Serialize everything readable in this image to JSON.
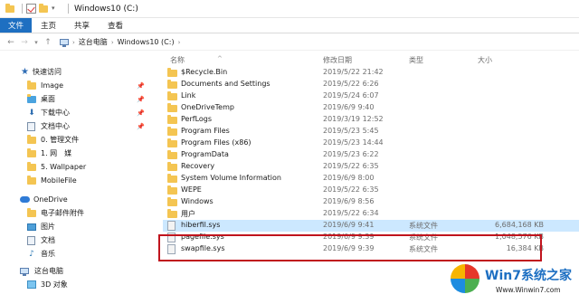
{
  "window": {
    "title": "Windows10 (C:)"
  },
  "ribbon": {
    "tabs": [
      "文件",
      "主页",
      "共享",
      "查看"
    ]
  },
  "address": {
    "parts": [
      "这台电脑",
      "Windows10 (C:)"
    ]
  },
  "navpane": {
    "quick_access": "快速访问",
    "items": [
      {
        "label": "Image",
        "pinned": true
      },
      {
        "label": "桌面",
        "pinned": true
      },
      {
        "label": "下载中心",
        "pinned": true
      },
      {
        "label": "文档中心",
        "pinned": true
      },
      {
        "label": "0. 管理文件",
        "pinned": false
      },
      {
        "label": "1. 网　媒",
        "pinned": false
      },
      {
        "label": "5. Wallpaper",
        "pinned": false
      },
      {
        "label": "MobileFile",
        "pinned": false
      }
    ],
    "onedrive": "OneDrive",
    "onedrive_items": [
      "电子邮件附件",
      "图片",
      "文档",
      "音乐"
    ],
    "this_pc": "这台电脑",
    "pc_items": [
      "3D 对象"
    ]
  },
  "columns": {
    "name": "名称",
    "date": "修改日期",
    "type": "类型",
    "size": "大小"
  },
  "files": [
    {
      "name": "$Recycle.Bin",
      "date": "2019/5/22 21:42",
      "type": "",
      "size": "",
      "icon": "folder"
    },
    {
      "name": "Documents and Settings",
      "date": "2019/5/22 6:26",
      "type": "",
      "size": "",
      "icon": "folder-link"
    },
    {
      "name": "Link",
      "date": "2019/5/24 6:07",
      "type": "",
      "size": "",
      "icon": "folder"
    },
    {
      "name": "OneDriveTemp",
      "date": "2019/6/9 9:40",
      "type": "",
      "size": "",
      "icon": "folder"
    },
    {
      "name": "PerfLogs",
      "date": "2019/3/19 12:52",
      "type": "",
      "size": "",
      "icon": "folder"
    },
    {
      "name": "Program Files",
      "date": "2019/5/23 5:45",
      "type": "",
      "size": "",
      "icon": "folder"
    },
    {
      "name": "Program Files (x86)",
      "date": "2019/5/23 14:44",
      "type": "",
      "size": "",
      "icon": "folder"
    },
    {
      "name": "ProgramData",
      "date": "2019/5/23 6:22",
      "type": "",
      "size": "",
      "icon": "folder"
    },
    {
      "name": "Recovery",
      "date": "2019/5/22 6:35",
      "type": "",
      "size": "",
      "icon": "folder"
    },
    {
      "name": "System Volume Information",
      "date": "2019/6/9 8:00",
      "type": "",
      "size": "",
      "icon": "folder"
    },
    {
      "name": "WEPE",
      "date": "2019/5/22 6:35",
      "type": "",
      "size": "",
      "icon": "folder"
    },
    {
      "name": "Windows",
      "date": "2019/6/9 8:56",
      "type": "",
      "size": "",
      "icon": "folder"
    },
    {
      "name": "用户",
      "date": "2019/5/22 6:34",
      "type": "",
      "size": "",
      "icon": "folder"
    },
    {
      "name": "hiberfil.sys",
      "date": "2019/6/9 9:41",
      "type": "系统文件",
      "size": "6,684,168 KB",
      "icon": "file",
      "selected": true
    },
    {
      "name": "pagefile.sys",
      "date": "2019/6/9 9:39",
      "type": "系统文件",
      "size": "1,048,576 KB",
      "icon": "file"
    },
    {
      "name": "swapfile.sys",
      "date": "2019/6/9 9:39",
      "type": "系统文件",
      "size": "16,384 KB",
      "icon": "file"
    }
  ],
  "watermark": {
    "brand": "Win7系统之家",
    "url": "Www.Winwin7.com"
  }
}
